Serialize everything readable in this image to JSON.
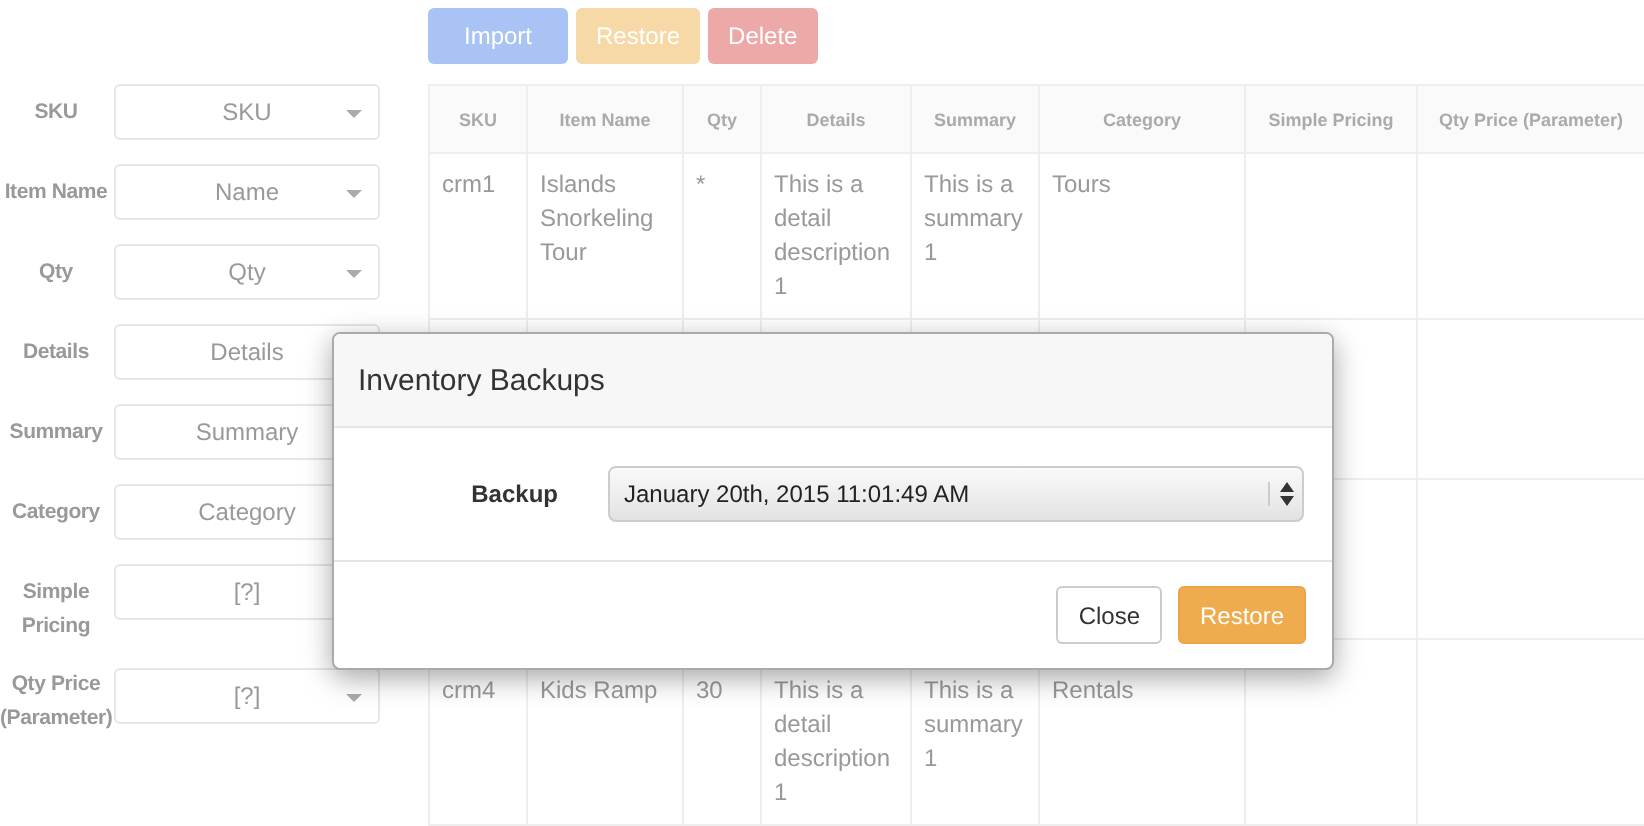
{
  "toolbar": {
    "buttons": [
      {
        "label": "Import",
        "kind": "primary"
      },
      {
        "label": "Restore",
        "kind": "warning"
      },
      {
        "label": "Delete",
        "kind": "danger"
      }
    ]
  },
  "mapping": [
    {
      "label": "SKU",
      "value": "SKU"
    },
    {
      "label": "Item Name",
      "value": "Name"
    },
    {
      "label": "Qty",
      "value": "Qty"
    },
    {
      "label": "Details",
      "value": "Details"
    },
    {
      "label": "Summary",
      "value": "Summary"
    },
    {
      "label": "Category",
      "value": "Category"
    },
    {
      "label": "Simple Pricing",
      "value": "[?]"
    },
    {
      "label": "Qty Price (Parameter)",
      "value": "[?]"
    }
  ],
  "table": {
    "columns": [
      "SKU",
      "Item Name",
      "Qty",
      "Details",
      "Summary",
      "Category",
      "Simple Pricing",
      "Qty Price (Parameter)"
    ],
    "rows": [
      [
        "crm1",
        "Islands Snorkeling Tour",
        "*",
        "This is a detail description 1",
        "This is a summary 1",
        "Tours",
        "",
        ""
      ],
      [
        "",
        "",
        "",
        "",
        "",
        "",
        "",
        ""
      ],
      [
        "",
        "",
        "",
        "",
        "",
        "",
        "",
        ""
      ],
      [
        "crm4",
        "Kids Ramp",
        "30",
        "This is a detail description 1",
        "This is a summary 1",
        "Rentals",
        "",
        ""
      ]
    ]
  },
  "modal": {
    "title": "Inventory Backups",
    "field_label": "Backup",
    "value": "January 20th, 2015 11:01:49 AM",
    "buttons": [
      {
        "label": "Close",
        "kind": "default"
      },
      {
        "label": "Restore",
        "kind": "warning"
      }
    ]
  }
}
